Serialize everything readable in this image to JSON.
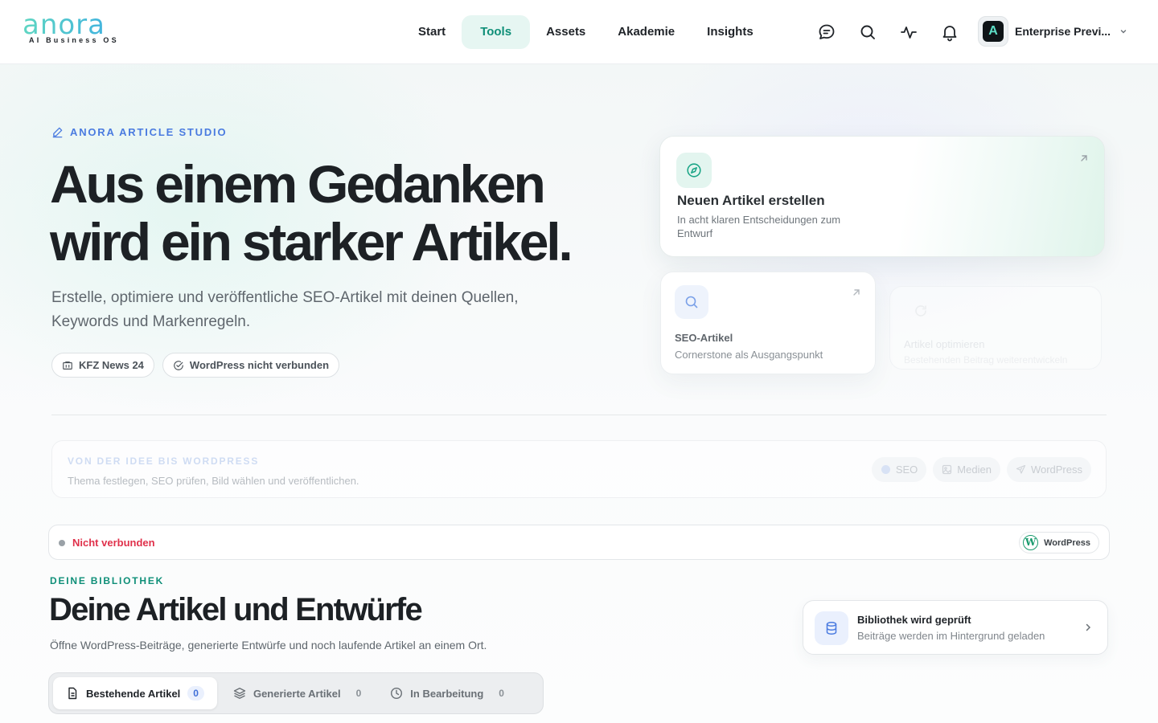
{
  "brand": {
    "logo": "anora",
    "tagline": "AI Business OS"
  },
  "nav": {
    "items": [
      {
        "label": "Start"
      },
      {
        "label": "Tools",
        "active": true
      },
      {
        "label": "Assets"
      },
      {
        "label": "Akademie"
      },
      {
        "label": "Insights"
      }
    ]
  },
  "header_icons": [
    "chat-icon",
    "search-icon",
    "activity-icon",
    "bell-icon"
  ],
  "account": {
    "avatar_letter": "A",
    "name": "Enterprise Previ..."
  },
  "hero": {
    "eyebrow": "ANORA ARTICLE STUDIO",
    "title_line1": "Aus einem Gedanken",
    "title_line2": "wird ein starker Artikel.",
    "subtitle": "Erstelle, optimiere und veröffentliche SEO-Artikel mit deinen Quellen, Keywords und Markenregeln.",
    "chips": [
      {
        "icon": "building-icon",
        "label": "KFZ News 24"
      },
      {
        "icon": "check-circle-icon",
        "label": "WordPress nicht verbunden"
      }
    ]
  },
  "cards": {
    "new_article": {
      "title": "Neuen Artikel erstellen",
      "description": "In acht klaren Entscheidungen zum Entwurf"
    },
    "seo_article": {
      "title": "SEO-Artikel",
      "description": "Cornerstone als Ausgangspunkt"
    },
    "optimize": {
      "title": "Artikel optimieren",
      "description": "Bestehenden Beitrag weiterentwickeln"
    }
  },
  "workflow": {
    "title": "VON DER IDEE BIS WORDPRESS",
    "description": "Thema festlegen, SEO prüfen, Bild wählen und veröffentlichen.",
    "chips": [
      "SEO",
      "Medien",
      "WordPress"
    ]
  },
  "connection": {
    "status": "Nicht verbunden",
    "platform": "WordPress"
  },
  "library": {
    "eyebrow": "DEINE BIBLIOTHEK",
    "title": "Deine Artikel und Entwürfe",
    "subtitle": "Öffne WordPress-Beiträge, generierte Entwürfe und noch laufende Artikel an einem Ort.",
    "status_title": "Bibliothek wird geprüft",
    "status_desc": "Beiträge werden im Hintergrund geladen",
    "tabs": [
      {
        "label": "Bestehende Artikel",
        "count": "0",
        "active": true
      },
      {
        "label": "Generierte Artikel",
        "count": "0"
      },
      {
        "label": "In Bearbeitung",
        "count": "0"
      }
    ]
  },
  "colors": {
    "accent": "#0f8f78",
    "accent_bg": "#e6f6f2",
    "link_blue": "#4a7be0",
    "error": "#e0314b"
  }
}
